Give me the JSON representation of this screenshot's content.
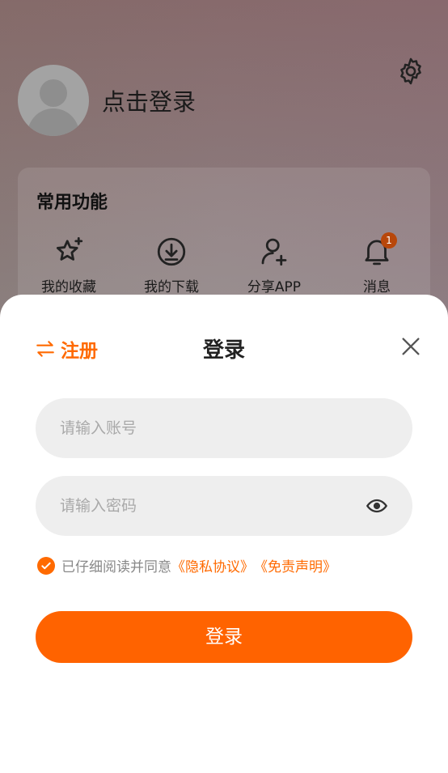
{
  "profile": {
    "login_prompt": "点击登录"
  },
  "features": {
    "title": "常用功能",
    "items": [
      {
        "label": "我的收藏",
        "icon": "star-icon"
      },
      {
        "label": "我的下载",
        "icon": "download-icon"
      },
      {
        "label": "分享APP",
        "icon": "add-user-icon"
      },
      {
        "label": "消息",
        "icon": "bell-icon",
        "badge": "1"
      }
    ]
  },
  "sheet": {
    "register_label": "注册",
    "title": "登录",
    "account_placeholder": "请输入账号",
    "password_placeholder": "请输入密码",
    "agree_text": "已仔细阅读并同意",
    "privacy_link": "《隐私协议》",
    "disclaimer_link": "《免责声明》",
    "submit_label": "登录"
  },
  "colors": {
    "accent": "#ff6300",
    "badge": "#b8470a",
    "field_bg": "#eeeeee"
  }
}
